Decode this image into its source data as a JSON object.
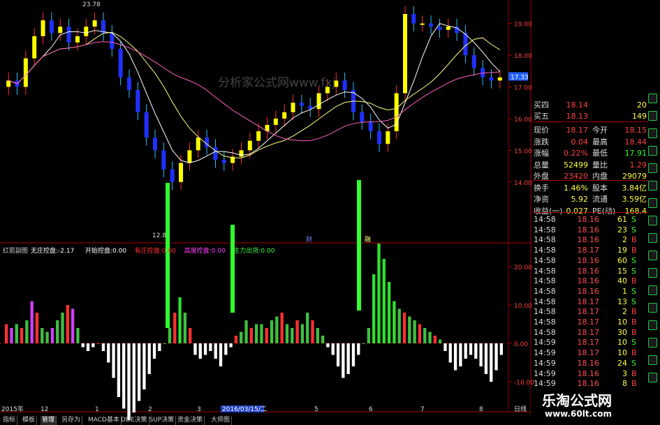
{
  "chart_data": [
    {
      "type": "candlestick",
      "title": "",
      "price_labels": [
        "19.00",
        "18.00",
        "17.00",
        "16.00",
        "15.00",
        "14.00"
      ],
      "price_ticks": [
        19,
        18,
        17,
        16,
        15,
        14
      ],
      "ylim": [
        12.3,
        19.3
      ],
      "current_price_label": "17.33",
      "high_label": "23.78",
      "low_label": "12.88",
      "overlay_text": "分析家公式网www.fxj",
      "series": [
        {
          "name": "close",
          "values": [
            17.2,
            17.0,
            17.9,
            18.6,
            19.1,
            18.7,
            18.9,
            18.4,
            18.6,
            18.9,
            19.1,
            18.7,
            18.2,
            17.3,
            16.9,
            16.2,
            15.4,
            15.0,
            14.4,
            14.0,
            14.6,
            15.0,
            15.4,
            15.1,
            14.7,
            14.6,
            14.8,
            15.0,
            15.3,
            15.6,
            15.8,
            16.0,
            16.2,
            16.5,
            16.4,
            16.3,
            16.8,
            17.0,
            17.2,
            16.9,
            16.2,
            15.9,
            15.6,
            15.2,
            15.6,
            16.8,
            19.3,
            19.0,
            19.0,
            18.9,
            18.8,
            18.9,
            18.7,
            18.0,
            17.6,
            17.3,
            17.2,
            17.3
          ]
        }
      ],
      "markers": [
        "财",
        "融"
      ]
    },
    {
      "type": "bar",
      "title": "红箭副图",
      "legend": [
        {
          "name": "无庄控盘:",
          "value": "-2.17",
          "color": "#ffffff"
        },
        {
          "name": "开始控盘:",
          "value": "0.00",
          "color": "#ffffff"
        },
        {
          "name": "有庄控盘:",
          "value": "0.00",
          "color": "#ff3030"
        },
        {
          "name": "高度控盘:",
          "value": "0.00",
          "color": "#ff40ff"
        },
        {
          "name": "主力出货:",
          "value": "0.00",
          "color": "#40ff40"
        }
      ],
      "ytick_labels": [
        "20.00",
        "10.00",
        "0.00",
        "-10.00"
      ],
      "yticks": [
        20,
        10,
        0,
        -10
      ],
      "ylim": [
        -16,
        24
      ],
      "values": [
        5,
        4,
        5,
        4,
        6,
        11,
        8,
        4,
        3,
        4,
        6,
        8,
        10,
        9,
        4,
        -1,
        -2,
        -1,
        0,
        -2,
        -5,
        -9,
        -14,
        -17,
        -20,
        -18,
        -15,
        -12,
        -8,
        -4,
        -2,
        0,
        4,
        8,
        12,
        8,
        4,
        -3,
        -4,
        -3,
        -2,
        -4,
        -6,
        -3,
        -1,
        2,
        3,
        6,
        4,
        5,
        5,
        4,
        6,
        7,
        8,
        5,
        4,
        6,
        5,
        8,
        6,
        4,
        2,
        -1,
        -3,
        -6,
        -9,
        -8,
        -6,
        -3,
        0,
        4,
        18,
        26,
        22,
        16,
        11,
        9,
        8,
        7,
        6,
        5,
        4,
        3,
        2,
        1,
        -2,
        -5,
        -7,
        -6,
        -4,
        -3,
        -4,
        -6,
        -8,
        -10,
        -7,
        -3
      ]
    }
  ],
  "date_axis": [
    "2015年",
    "12",
    "1",
    "2",
    "2016/03/15/二",
    "3",
    "5",
    "6",
    "7",
    "8",
    "日线"
  ],
  "quote": {
    "book": [
      {
        "label": "买四",
        "price": "18.14",
        "vol": "20"
      },
      {
        "label": "买五",
        "price": "18.13",
        "vol": "149"
      }
    ],
    "stats": [
      {
        "l1": "现价",
        "v1": "18.17",
        "l2": "今开",
        "v2": "18.15"
      },
      {
        "l1": "涨跌",
        "v1": "0.04",
        "l2": "最高",
        "v2": "18.44"
      },
      {
        "l1": "涨幅",
        "v1": "0.22%",
        "l2": "最低",
        "v2": "17.91"
      },
      {
        "l1": "总量",
        "v1": "52499",
        "l2": "量比",
        "v2": "1.29"
      },
      {
        "l1": "外盘",
        "v1": "23420",
        "l2": "内盘",
        "v2": "29079"
      },
      {
        "l1": "换手",
        "v1": "1.46%",
        "l2": "股本",
        "v2": "3.84亿"
      },
      {
        "l1": "净资",
        "v1": "5.92",
        "l2": "流通",
        "v2": "3.59亿"
      },
      {
        "l1": "收益(一)",
        "v1": "0.027",
        "l2": "PE(动)",
        "v2": "168.4"
      }
    ],
    "ticks": [
      {
        "time": "14:58",
        "price": "18.16",
        "vol": "61",
        "side": "S"
      },
      {
        "time": "14:58",
        "price": "18.16",
        "vol": "23",
        "side": "S"
      },
      {
        "time": "14:58",
        "price": "18.16",
        "vol": "2",
        "side": "B"
      },
      {
        "time": "14:58",
        "price": "18.17",
        "vol": "19",
        "side": "B"
      },
      {
        "time": "14:58",
        "price": "18.16",
        "vol": "60",
        "side": "S"
      },
      {
        "time": "14:58",
        "price": "18.16",
        "vol": "15",
        "side": "S"
      },
      {
        "time": "14:58",
        "price": "18.16",
        "vol": "40",
        "side": "B"
      },
      {
        "time": "14:58",
        "price": "18.16",
        "vol": "1",
        "side": "S"
      },
      {
        "time": "14:58",
        "price": "18.17",
        "vol": "13",
        "side": "S"
      },
      {
        "time": "14:58",
        "price": "18.17",
        "vol": "2",
        "side": "B"
      },
      {
        "time": "14:58",
        "price": "18.17",
        "vol": "10",
        "side": "B"
      },
      {
        "time": "14:58",
        "price": "18.17",
        "vol": "30",
        "side": "B"
      },
      {
        "time": "14:59",
        "price": "18.17",
        "vol": "10",
        "side": "S"
      },
      {
        "time": "14:59",
        "price": "18.17",
        "vol": "10",
        "side": "B"
      },
      {
        "time": "14:59",
        "price": "18.16",
        "vol": "24",
        "side": "S"
      },
      {
        "time": "14:59",
        "price": "18.16",
        "vol": "3",
        "side": "B"
      },
      {
        "time": "14:59",
        "price": "18.16",
        "vol": "8",
        "side": "B"
      }
    ]
  },
  "tabs": [
    "指标",
    "模板",
    "管理",
    "另存为",
    "MACD基本",
    "DDE决策",
    "SUP决策",
    "资金决策",
    "大师图"
  ],
  "watermark": {
    "line1": "乐淘公式网",
    "line2": "www.60lt.com"
  }
}
